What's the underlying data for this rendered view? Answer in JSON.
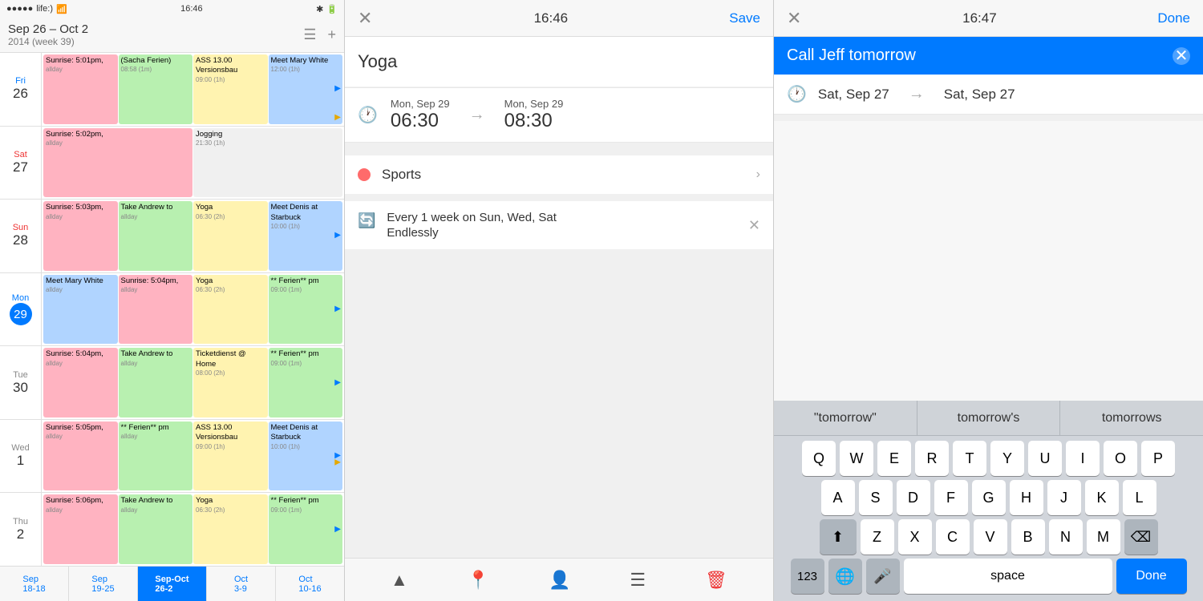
{
  "panel1": {
    "status_bar": {
      "dots": "●●●●●",
      "carrier": "life:)",
      "wifi": "WiFi",
      "time": "16:46",
      "battery": "🔋"
    },
    "header": {
      "title": "Sep 26 – Oct 2",
      "subtitle": "2014 (week 39)",
      "icon_menu": "☰",
      "icon_add": "+"
    },
    "rows": [
      {
        "dow": "Fri",
        "dom": "26",
        "today": false,
        "fri": true,
        "events": [
          {
            "text": "Sunrise: 5:01pm,",
            "color": "pink",
            "extra": "allday"
          },
          {
            "text": "(Sacha Ferien)",
            "color": "green",
            "extra": "08:58 (1m)"
          },
          {
            "text": "ASS 13.00 Versionsbau",
            "color": "yellow",
            "extra": "09:00 (1h)"
          },
          {
            "text": "Meet Mary White",
            "color": "blue",
            "extra": "12:00 (1h)",
            "arrow": true
          }
        ]
      },
      {
        "dow": "Sat",
        "dom": "27",
        "today": false,
        "sat": true,
        "events": [
          {
            "text": "Sunrise: 5:02pm,",
            "color": "pink",
            "extra": "allday"
          },
          {
            "text": "Jogging",
            "color": "light",
            "extra": "21:30 (1h)"
          }
        ]
      },
      {
        "dow": "Sun",
        "dom": "28",
        "today": false,
        "sun": true,
        "events": [
          {
            "text": "Sunrise: 5:03pm,",
            "color": "pink",
            "extra": "allday"
          },
          {
            "text": "Take Andrew to",
            "color": "green",
            "extra": "allday"
          },
          {
            "text": "Yoga",
            "color": "yellow",
            "extra": "06:30 (2h)"
          },
          {
            "text": "Meet Denis at Starbuck",
            "color": "blue",
            "extra": "10:00 (1h)",
            "arrow": true
          }
        ]
      },
      {
        "dow": "Mon",
        "dom": "29",
        "today": true,
        "events": [
          {
            "text": "Meet Mary White",
            "color": "blue",
            "extra": "allday"
          },
          {
            "text": "Sunrise: 5:04pm,",
            "color": "pink",
            "extra": "allday"
          },
          {
            "text": "Yoga",
            "color": "yellow",
            "extra": "06:30 (2h)"
          },
          {
            "text": "** Ferien** pm",
            "color": "green",
            "extra": "09:00 (1m)",
            "arrow": true
          }
        ]
      },
      {
        "dow": "Tue",
        "dom": "30",
        "today": false,
        "events": [
          {
            "text": "Sunrise: 5:04pm,",
            "color": "pink",
            "extra": "allday"
          },
          {
            "text": "Take Andrew to",
            "color": "green",
            "extra": "allday"
          },
          {
            "text": "Ticketdienst @ Home",
            "color": "yellow",
            "extra": "08:00 (2h)"
          },
          {
            "text": "** Ferien** pm",
            "color": "green",
            "extra": "09:00 (1m)",
            "arrow": true
          }
        ]
      },
      {
        "dow": "Wed",
        "dom": "1",
        "today": false,
        "events": [
          {
            "text": "Sunrise: 5:05pm,",
            "color": "pink",
            "extra": "allday"
          },
          {
            "text": "** Ferien** pm",
            "color": "green",
            "extra": "allday"
          },
          {
            "text": "ASS 13.00 Versionsbau",
            "color": "yellow",
            "extra": "09:00 (1h)"
          },
          {
            "text": "Meet Denis at Starbuck",
            "color": "blue",
            "extra": "10:00 (1h)",
            "arrow": true
          }
        ]
      },
      {
        "dow": "Thu",
        "dom": "2",
        "today": false,
        "events": [
          {
            "text": "Sunrise: 5:06pm,",
            "color": "pink",
            "extra": "allday"
          },
          {
            "text": "Take Andrew to",
            "color": "green",
            "extra": "allday"
          },
          {
            "text": "Yoga",
            "color": "yellow",
            "extra": "06:30 (2h)"
          },
          {
            "text": "** Ferien** pm",
            "color": "green",
            "extra": "09:00 (1m)",
            "arrow": true
          }
        ]
      }
    ],
    "footer": [
      {
        "label": "Sep 18–18",
        "active": false
      },
      {
        "label": "Sep 19–25",
        "active": false
      },
      {
        "label": "Sep–Oct 26–2",
        "active": true
      },
      {
        "label": "Oct 3–9",
        "active": false
      },
      {
        "label": "Oct 10–16",
        "active": false
      }
    ]
  },
  "panel2": {
    "nav": {
      "close": "✕",
      "time": "16:46",
      "action": "Save"
    },
    "event_title": "Yoga",
    "start_date": "Mon, Sep 29",
    "start_time": "06:30",
    "end_date": "Mon, Sep 29",
    "end_time": "08:30",
    "calendar": "Sports",
    "repeat_freq": "Every 1 week on Sun, Wed, Sat",
    "repeat_end": "Endlessly",
    "toolbar_icons": [
      "🔔",
      "📍",
      "👤",
      "📝",
      "🗑"
    ]
  },
  "panel3": {
    "nav": {
      "close": "✕",
      "time": "16:47",
      "action": "Done"
    },
    "input_value": "Call Jeff tomorrow",
    "start_date": "Sat, Sep 27",
    "end_date": "Sat, Sep 27",
    "suggestions": [
      "\"tomorrow\"",
      "tomorrow's",
      "tomorrows"
    ],
    "keyboard_rows": [
      [
        "Q",
        "W",
        "E",
        "R",
        "T",
        "Y",
        "U",
        "I",
        "O",
        "P"
      ],
      [
        "A",
        "S",
        "D",
        "F",
        "G",
        "H",
        "J",
        "K",
        "L"
      ],
      [
        "⬆",
        "Z",
        "X",
        "C",
        "V",
        "B",
        "N",
        "M",
        "⌫"
      ],
      [
        "123",
        "🌐",
        "🎤",
        "space",
        "Done"
      ]
    ]
  }
}
